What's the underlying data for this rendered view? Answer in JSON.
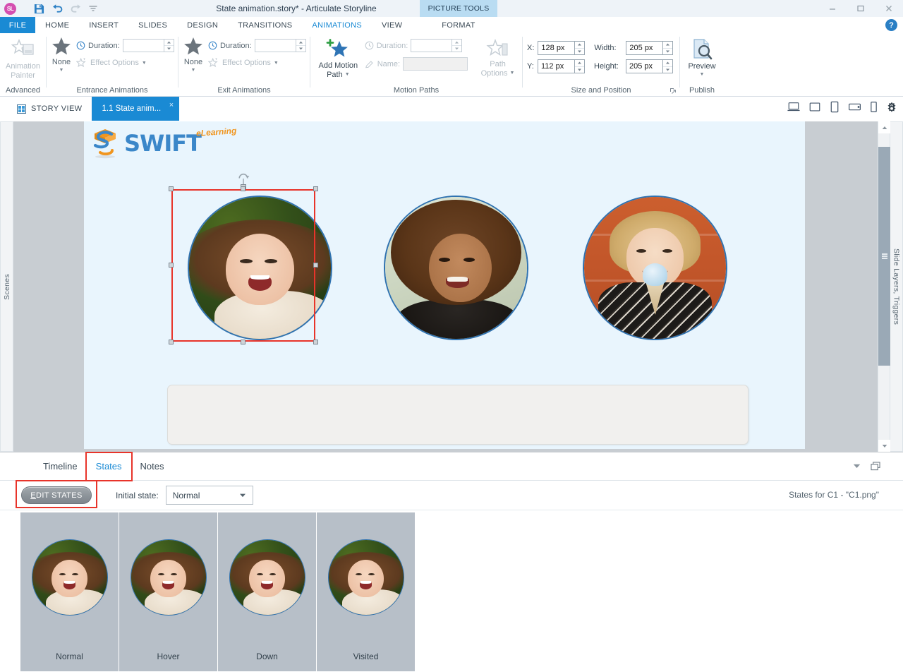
{
  "app": {
    "title": "State animation.story* - Articulate Storyline",
    "logo_text": "SL",
    "contextual_tools": "PICTURE TOOLS"
  },
  "quick_access": [
    {
      "name": "save-icon",
      "label": "Save"
    },
    {
      "name": "undo-icon",
      "label": "Undo"
    },
    {
      "name": "redo-icon",
      "label": "Redo"
    },
    {
      "name": "customize-qat-icon",
      "label": "Customize Quick Access Toolbar"
    }
  ],
  "window_controls": [
    {
      "name": "minimize-button",
      "glyph": "–"
    },
    {
      "name": "maximize-button",
      "glyph": "□"
    },
    {
      "name": "close-button",
      "glyph": "×"
    }
  ],
  "help_button": "?",
  "ribbon_tabs": [
    {
      "label": "FILE",
      "id": "file"
    },
    {
      "label": "HOME",
      "id": "home"
    },
    {
      "label": "INSERT",
      "id": "insert"
    },
    {
      "label": "SLIDES",
      "id": "slides"
    },
    {
      "label": "DESIGN",
      "id": "design"
    },
    {
      "label": "TRANSITIONS",
      "id": "transitions"
    },
    {
      "label": "ANIMATIONS",
      "id": "animations",
      "active": true
    },
    {
      "label": "VIEW",
      "id": "view"
    },
    {
      "label": "HELP",
      "id": "help"
    }
  ],
  "ribbon_tab_format": "FORMAT",
  "ribbon": {
    "advanced": {
      "group_label": "Advanced",
      "animation_painter": "Animation\nPainter",
      "animation_painter_line1": "Animation",
      "animation_painter_line2": "Painter"
    },
    "entrance": {
      "group_label": "Entrance Animations",
      "none_label": "None",
      "duration_label": "Duration:",
      "duration_value": "",
      "effect_options_label": "Effect Options"
    },
    "exit": {
      "group_label": "Exit Animations",
      "none_label": "None",
      "duration_label": "Duration:",
      "duration_value": "",
      "effect_options_label": "Effect Options"
    },
    "motion_paths": {
      "group_label": "Motion Paths",
      "add_motion_path_line1": "Add Motion",
      "add_motion_path_line2": "Path",
      "duration_label": "Duration:",
      "duration_value": "",
      "name_label": "Name:",
      "name_value": "",
      "path_options_line1": "Path",
      "path_options_line2": "Options"
    },
    "size_position": {
      "group_label": "Size and Position",
      "x_label": "X:",
      "x_value": "128 px",
      "y_label": "Y:",
      "y_value": "112 px",
      "width_label": "Width:",
      "width_value": "205 px",
      "height_label": "Height:",
      "height_value": "205 px"
    },
    "publish": {
      "group_label": "Publish",
      "preview_label": "Preview"
    }
  },
  "viewstrip": {
    "story_view": "STORY VIEW",
    "slide_tab": "1.1 State anim...",
    "slide_tab_close": "×",
    "device_icons": [
      {
        "name": "desktop-preview-icon"
      },
      {
        "name": "monitor-preview-icon"
      },
      {
        "name": "tablet-portrait-preview-icon"
      },
      {
        "name": "tablet-landscape-preview-icon"
      },
      {
        "name": "phone-preview-icon"
      },
      {
        "name": "preview-settings-gear-icon"
      }
    ]
  },
  "rails": {
    "left": "Scenes",
    "right": "Slide Layers, Triggers"
  },
  "slide": {
    "logo": {
      "brand": "SWIFT",
      "tagline": "eLearning"
    },
    "images": [
      {
        "name": "photo-girl-grass",
        "alt": "Laughing girl lying on grass",
        "selected": true
      },
      {
        "name": "photo-girl-curly",
        "alt": "Smiling girl with curly hair",
        "selected": false
      },
      {
        "name": "photo-boy-icecream",
        "alt": "Boy eating ice cream by orange wall",
        "selected": false
      }
    ],
    "textbox": {
      "name": "empty-rounded-textbox",
      "text": ""
    }
  },
  "bottom_panel": {
    "tabs": [
      {
        "label": "Timeline",
        "id": "timeline",
        "active": false,
        "highlighted": false
      },
      {
        "label": "States",
        "id": "states",
        "active": true,
        "highlighted": true
      },
      {
        "label": "Notes",
        "id": "notes",
        "active": false,
        "highlighted": false
      }
    ],
    "panel_tools": [
      {
        "name": "panel-collapse-caret-icon"
      },
      {
        "name": "panel-restore-icon"
      }
    ],
    "edit_states_button": {
      "accel": "E",
      "rest": "DIT STATES",
      "full": "EDIT STATES",
      "highlighted": true
    },
    "initial_state_label": "Initial state:",
    "initial_state_value": "Normal",
    "initial_state_options": [
      "Normal",
      "Hover",
      "Down",
      "Visited"
    ],
    "states_for": "States for C1 - \"C1.png\"",
    "states": [
      {
        "label": "Normal"
      },
      {
        "label": "Hover"
      },
      {
        "label": "Down"
      },
      {
        "label": "Visited"
      }
    ]
  },
  "colors": {
    "accent_blue": "#1a8ad4",
    "highlight_red": "#e8342a",
    "ribbon_bg": "#ffffff",
    "titlebar_bg": "#eef3f8",
    "canvas_bg": "#c8cdd2",
    "slide_bg": "#e9f5fd",
    "state_card_bg": "#b7bfc8",
    "logo_blue": "#3b87c9",
    "logo_orange": "#f0951e"
  }
}
